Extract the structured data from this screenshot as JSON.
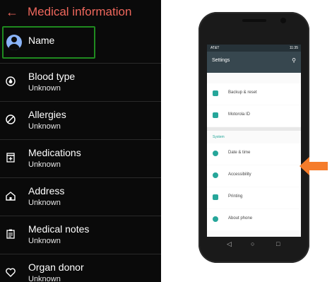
{
  "left": {
    "title": "Medical information",
    "name_label": "Name",
    "items": [
      {
        "label": "Blood type",
        "value": "Unknown",
        "icon": "drop-icon"
      },
      {
        "label": "Allergies",
        "value": "Unknown",
        "icon": "blocked-icon"
      },
      {
        "label": "Medications",
        "value": "Unknown",
        "icon": "medication-icon"
      },
      {
        "label": "Address",
        "value": "Unknown",
        "icon": "home-icon"
      },
      {
        "label": "Medical notes",
        "value": "Unknown",
        "icon": "notes-icon"
      },
      {
        "label": "Organ donor",
        "value": "Unknown",
        "icon": "heart-icon"
      }
    ],
    "colors": {
      "accent": "#ee675c",
      "highlight": "#1f8a1f",
      "background": "#0a0a0a"
    }
  },
  "phone": {
    "carrier": "AT&T",
    "time": "11:35",
    "app_title": "Settings",
    "section": "System",
    "rows_top": [
      "Backup & reset",
      "Motorola ID"
    ],
    "rows_system": [
      "Date & time",
      "Accessibility",
      "Printing",
      "About phone"
    ],
    "colors": {
      "appbar": "#37474f",
      "accent": "#26a69a",
      "arrow": "#f57c2b"
    }
  }
}
